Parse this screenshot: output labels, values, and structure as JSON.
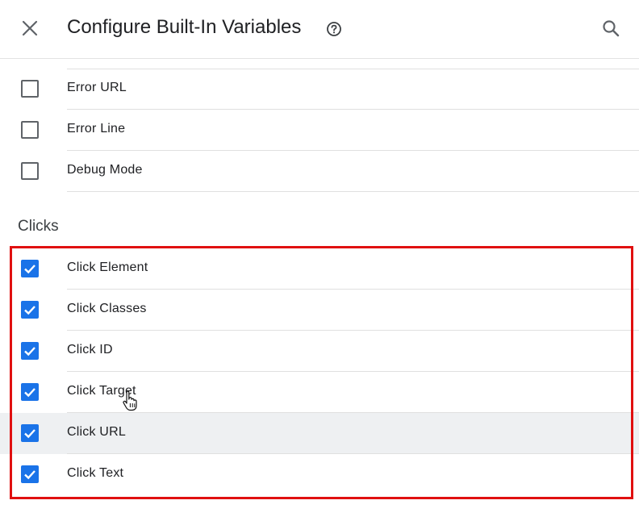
{
  "header": {
    "title": "Configure Built-In Variables"
  },
  "errors": {
    "items": [
      {
        "label": "Error URL",
        "checked": false
      },
      {
        "label": "Error Line",
        "checked": false
      },
      {
        "label": "Debug Mode",
        "checked": false
      }
    ]
  },
  "clicks": {
    "section_title": "Clicks",
    "items": [
      {
        "label": "Click Element",
        "checked": true
      },
      {
        "label": "Click Classes",
        "checked": true
      },
      {
        "label": "Click ID",
        "checked": true
      },
      {
        "label": "Click Target",
        "checked": true
      },
      {
        "label": "Click URL",
        "checked": true
      },
      {
        "label": "Click Text",
        "checked": true
      }
    ]
  },
  "colors": {
    "checkbox_checked": "#1a73e8",
    "annotation_box": "#e01010"
  },
  "icons": {
    "close": "close-icon",
    "help": "help-circle-icon",
    "search": "search-icon",
    "pointer": "hand-pointer-cursor"
  }
}
